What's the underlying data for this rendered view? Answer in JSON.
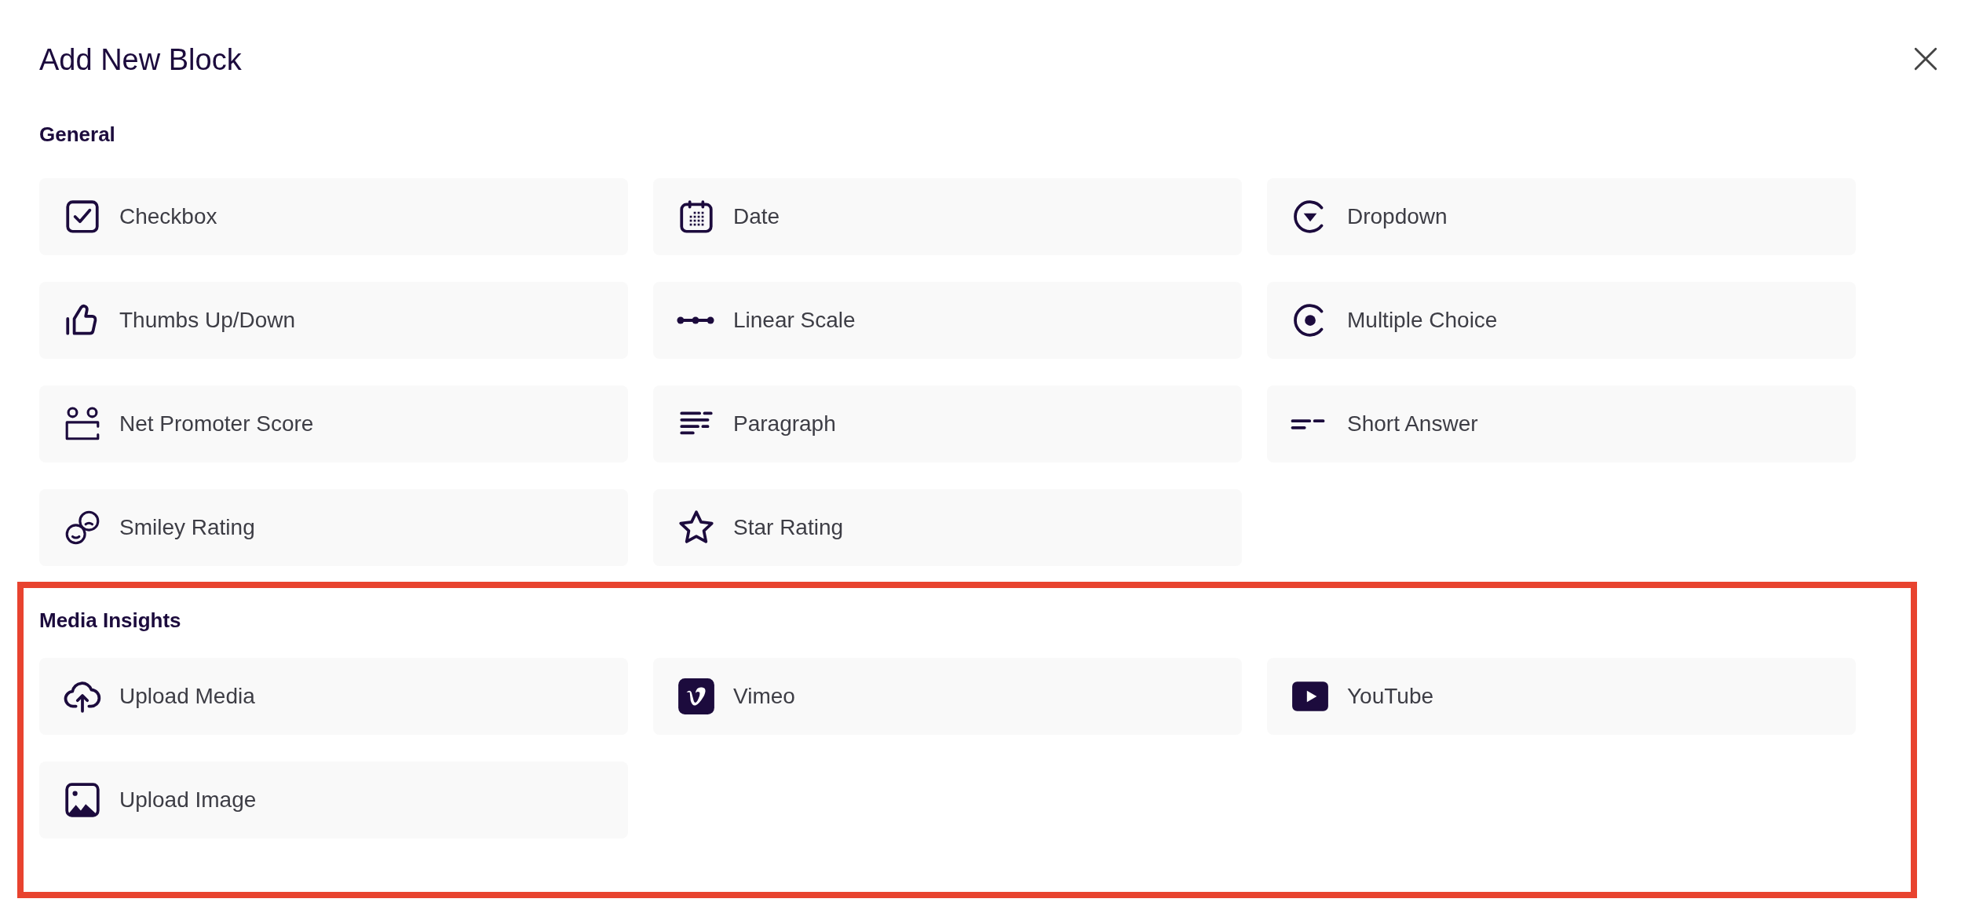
{
  "title": "Add New Block",
  "sections": [
    {
      "heading": "General",
      "highlighted": false,
      "items": [
        {
          "kind": "checkbox",
          "label": "Checkbox"
        },
        {
          "kind": "date",
          "label": "Date"
        },
        {
          "kind": "dropdown",
          "label": "Dropdown"
        },
        {
          "kind": "thumbs",
          "label": "Thumbs Up/Down"
        },
        {
          "kind": "linear",
          "label": "Linear Scale"
        },
        {
          "kind": "choice",
          "label": "Multiple Choice"
        },
        {
          "kind": "nps",
          "label": "Net Promoter Score"
        },
        {
          "kind": "paragraph",
          "label": "Paragraph"
        },
        {
          "kind": "short",
          "label": "Short Answer"
        },
        {
          "kind": "smiley",
          "label": "Smiley Rating"
        },
        {
          "kind": "star",
          "label": "Star Rating"
        }
      ]
    },
    {
      "heading": "Media Insights",
      "highlighted": true,
      "items": [
        {
          "kind": "upload",
          "label": "Upload Media"
        },
        {
          "kind": "vimeo",
          "label": "Vimeo"
        },
        {
          "kind": "youtube",
          "label": "YouTube"
        },
        {
          "kind": "image",
          "label": "Upload Image"
        }
      ]
    }
  ]
}
